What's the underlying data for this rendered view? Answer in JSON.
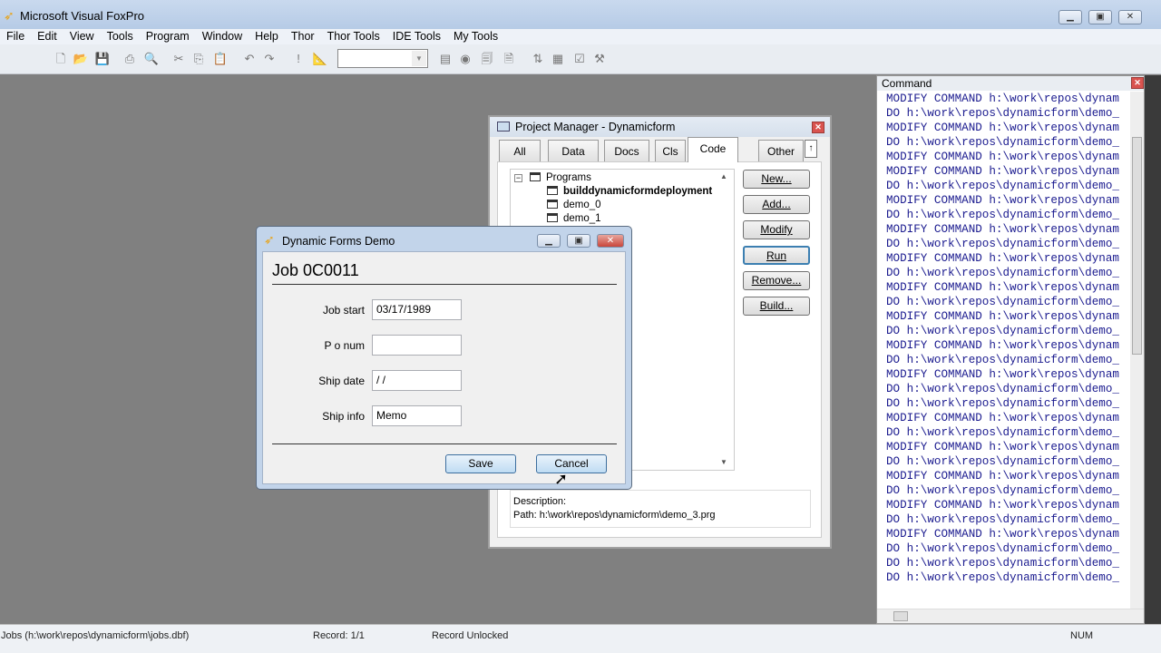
{
  "app": {
    "title": "Microsoft Visual FoxPro"
  },
  "menu": [
    "File",
    "Edit",
    "View",
    "Tools",
    "Program",
    "Window",
    "Help",
    "Thor",
    "Thor Tools",
    "IDE Tools",
    "My Tools"
  ],
  "toolbar": {
    "combo_value": ""
  },
  "command": {
    "title": "Command",
    "lines": [
      "MODIFY COMMAND h:\\work\\repos\\dynam",
      "DO h:\\work\\repos\\dynamicform\\demo_",
      "MODIFY COMMAND h:\\work\\repos\\dynam",
      "DO h:\\work\\repos\\dynamicform\\demo_",
      "MODIFY COMMAND h:\\work\\repos\\dynam",
      "MODIFY COMMAND h:\\work\\repos\\dynam",
      "DO h:\\work\\repos\\dynamicform\\demo_",
      "MODIFY COMMAND h:\\work\\repos\\dynam",
      "DO h:\\work\\repos\\dynamicform\\demo_",
      "MODIFY COMMAND h:\\work\\repos\\dynam",
      "DO h:\\work\\repos\\dynamicform\\demo_",
      "MODIFY COMMAND h:\\work\\repos\\dynam",
      "DO h:\\work\\repos\\dynamicform\\demo_",
      "MODIFY COMMAND h:\\work\\repos\\dynam",
      "DO h:\\work\\repos\\dynamicform\\demo_",
      "MODIFY COMMAND h:\\work\\repos\\dynam",
      "DO h:\\work\\repos\\dynamicform\\demo_",
      "MODIFY COMMAND h:\\work\\repos\\dynam",
      "DO h:\\work\\repos\\dynamicform\\demo_",
      "MODIFY COMMAND h:\\work\\repos\\dynam",
      "DO h:\\work\\repos\\dynamicform\\demo_",
      "DO h:\\work\\repos\\dynamicform\\demo_",
      "MODIFY COMMAND h:\\work\\repos\\dynam",
      "DO h:\\work\\repos\\dynamicform\\demo_",
      "MODIFY COMMAND h:\\work\\repos\\dynam",
      "DO h:\\work\\repos\\dynamicform\\demo_",
      "MODIFY COMMAND h:\\work\\repos\\dynam",
      "DO h:\\work\\repos\\dynamicform\\demo_",
      "MODIFY COMMAND h:\\work\\repos\\dynam",
      "DO h:\\work\\repos\\dynamicform\\demo_",
      "MODIFY COMMAND h:\\work\\repos\\dynam",
      "DO h:\\work\\repos\\dynamicform\\demo_",
      "DO h:\\work\\repos\\dynamicform\\demo_",
      "DO h:\\work\\repos\\dynamicform\\demo_"
    ]
  },
  "project": {
    "title": "Project Manager - Dynamicform",
    "tabs": [
      "All",
      "Data",
      "Docs",
      "Cls",
      "Code",
      "Other"
    ],
    "active_tab": "Code",
    "tree": {
      "root": "Programs",
      "items": [
        "builddynamicformdeployment",
        "demo_0",
        "demo_1"
      ]
    },
    "buttons": [
      "New...",
      "Add...",
      "Modify",
      "Run",
      "Remove...",
      "Build..."
    ],
    "description_label": "Description:",
    "path": "Path: h:\\work\\repos\\dynamicform\\demo_3.prg"
  },
  "dialog": {
    "title": "Dynamic Forms Demo",
    "heading": "Job 0C0011",
    "fields": [
      {
        "label": "Job start",
        "value": "03/17/1989"
      },
      {
        "label": "P o num",
        "value": ""
      },
      {
        "label": "Ship date",
        "value": " / /"
      },
      {
        "label": "Ship info",
        "value": "Memo"
      }
    ],
    "save": "Save",
    "cancel": "Cancel"
  },
  "status": {
    "table": "Jobs (h:\\work\\repos\\dynamicform\\jobs.dbf)",
    "record": "Record: 1/1",
    "lock": "Record Unlocked",
    "num": "NUM"
  }
}
